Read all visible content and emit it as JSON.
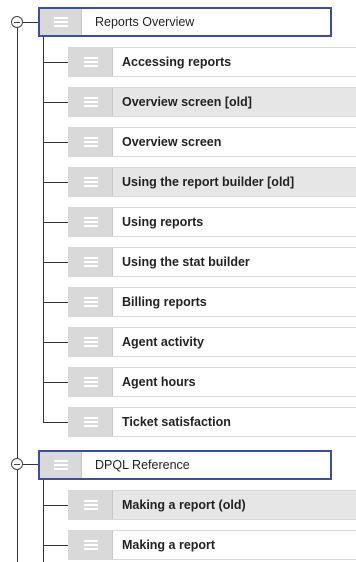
{
  "sections": [
    {
      "title": "Reports Overview",
      "items": [
        {
          "label": "Accessing reports",
          "shade": "white"
        },
        {
          "label": "Overview screen [old]",
          "shade": "gray"
        },
        {
          "label": "Overview screen",
          "shade": "white"
        },
        {
          "label": "Using the report builder [old]",
          "shade": "gray"
        },
        {
          "label": "Using reports",
          "shade": "white"
        },
        {
          "label": "Using the stat builder",
          "shade": "white"
        },
        {
          "label": "Billing reports",
          "shade": "white"
        },
        {
          "label": "Agent activity",
          "shade": "white"
        },
        {
          "label": "Agent hours",
          "shade": "white"
        },
        {
          "label": "Ticket satisfaction",
          "shade": "white"
        }
      ]
    },
    {
      "title": "DPQL Reference",
      "items": [
        {
          "label": "Making a report (old)",
          "shade": "gray"
        },
        {
          "label": "Making a report",
          "shade": "white"
        }
      ]
    }
  ],
  "icons": {
    "toggle": "collapse-circle-minus-icon",
    "handle": "drag-handle-icon"
  },
  "colors": {
    "parent_border": "#3a4fa0",
    "handle_bg": "#d9d9d9",
    "gray_row": "#e6e6e6",
    "text": "#222222"
  }
}
